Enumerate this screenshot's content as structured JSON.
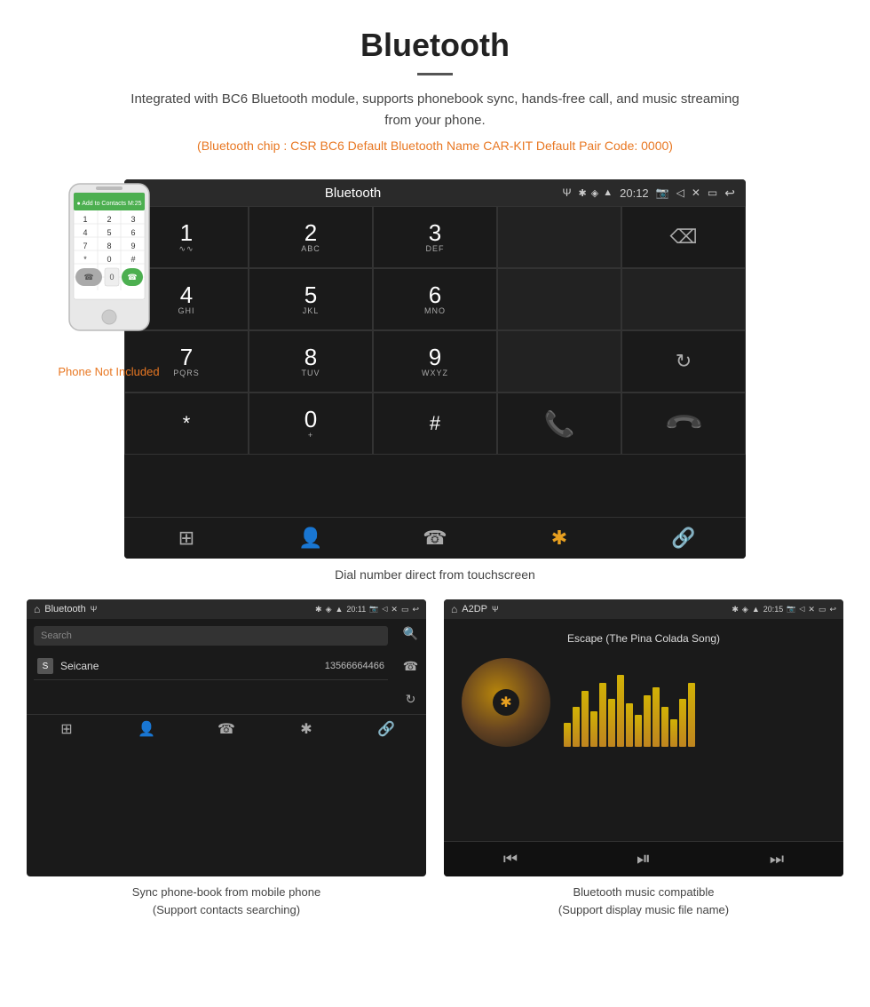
{
  "page": {
    "title": "Bluetooth",
    "description": "Integrated with BC6 Bluetooth module, supports phonebook sync, hands-free call, and music streaming from your phone.",
    "specs": "(Bluetooth chip : CSR BC6    Default Bluetooth Name CAR-KIT    Default Pair Code: 0000)"
  },
  "dial_screen": {
    "statusbar": {
      "title": "Bluetooth",
      "time": "20:12",
      "home_icon": "⌂",
      "usb_icon": "Ψ"
    },
    "keys": [
      {
        "num": "1",
        "sub": "∿∿"
      },
      {
        "num": "2",
        "sub": "ABC"
      },
      {
        "num": "3",
        "sub": "DEF"
      },
      {
        "num": "",
        "sub": ""
      },
      {
        "num": "⌫",
        "sub": ""
      },
      {
        "num": "4",
        "sub": "GHI"
      },
      {
        "num": "5",
        "sub": "JKL"
      },
      {
        "num": "6",
        "sub": "MNO"
      },
      {
        "num": "",
        "sub": ""
      },
      {
        "num": "",
        "sub": ""
      },
      {
        "num": "7",
        "sub": "PQRS"
      },
      {
        "num": "8",
        "sub": "TUV"
      },
      {
        "num": "9",
        "sub": "WXYZ"
      },
      {
        "num": "",
        "sub": ""
      },
      {
        "num": "↻",
        "sub": ""
      },
      {
        "num": "*",
        "sub": ""
      },
      {
        "num": "0",
        "sub": "+"
      },
      {
        "num": "#",
        "sub": ""
      },
      {
        "num": "☎",
        "sub": ""
      },
      {
        "num": "☎end",
        "sub": ""
      }
    ],
    "bottom_icons": [
      "⊞",
      "👤",
      "☎",
      "✱",
      "🔗"
    ],
    "caption": "Dial number direct from touchscreen"
  },
  "phone_note": {
    "label": "Phone Not Included"
  },
  "phonebook_screen": {
    "statusbar_title": "Bluetooth",
    "time": "20:11",
    "search_placeholder": "Search",
    "contact_name": "Seicane",
    "contact_number": "13566664466",
    "contact_letter": "S",
    "bottom_icons": [
      "⊞",
      "👤",
      "☎",
      "✱",
      "🔗"
    ],
    "caption_line1": "Sync phone-book from mobile phone",
    "caption_line2": "(Support contacts searching)"
  },
  "music_screen": {
    "statusbar_title": "A2DP",
    "time": "20:15",
    "song_title": "Escape (The Pina Colada Song)",
    "eq_bars": [
      30,
      50,
      70,
      45,
      80,
      60,
      90,
      55,
      40,
      65,
      75,
      50,
      35,
      60,
      80
    ],
    "caption_line1": "Bluetooth music compatible",
    "caption_line2": "(Support display music file name)"
  },
  "colors": {
    "accent_orange": "#e87722",
    "screen_bg": "#1a1a1a",
    "statusbar_bg": "#2a2a2a",
    "call_green": "#4caf50",
    "call_red": "#f44336",
    "active_icon": "#e8a020"
  }
}
